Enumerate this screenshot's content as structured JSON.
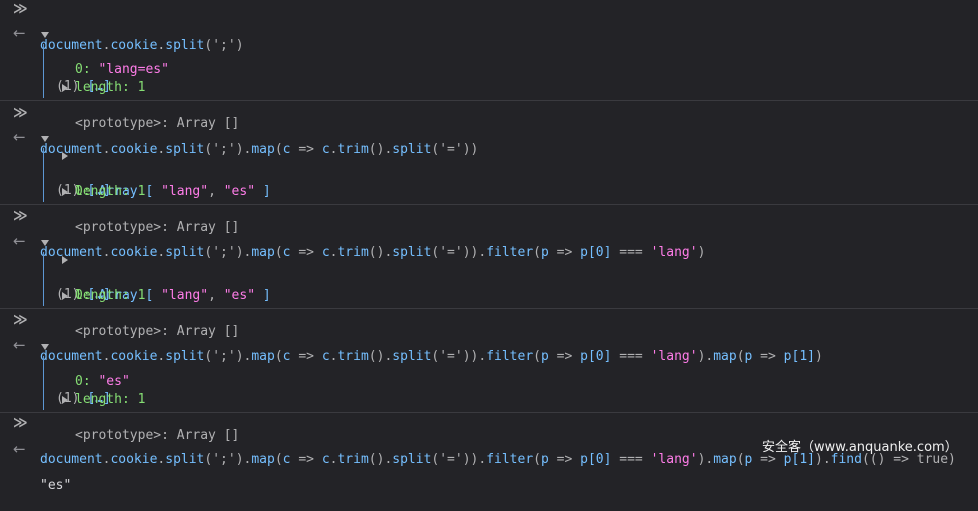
{
  "prompt_icon": "chevron-double-right-icon",
  "result_icon": "arrow-left-icon",
  "code_tokens": {
    "document": "document",
    "dot": ".",
    "cookie": "cookie",
    "split": "split",
    "open_semicolon": "(';')",
    "map": "map",
    "paren_open": "(",
    "c": "c",
    "arrow": " => ",
    "trim": "trim",
    "empty_call": "()",
    "eq_arg": "('=')",
    "close": ")",
    "filter": "filter",
    "p": "p",
    "p0": "p[0]",
    "strict_eq": " === ",
    "lang_str": "'lang'",
    "p1": "p[1]",
    "find": "find",
    "lambda_empty": "(() => true)"
  },
  "commands": [
    "document.cookie.split(';')",
    "document.cookie.split(';').map(c => c.trim().split('='))",
    "document.cookie.split(';').map(c => c.trim().split('=')).filter(p => p[0] === 'lang')",
    "document.cookie.split(';').map(c => c.trim().split('=')).filter(p => p[0] === 'lang').map(p => p[1])",
    "document.cookie.split(';').map(c => c.trim().split('=')).filter(p => p[0] === 'lang').map(p => p[1]).find(() => true)"
  ],
  "results": {
    "array_header_count": "(1) ",
    "array_header_ellipsis": "[…]",
    "r1_index": "0: ",
    "r1_value": "\"lang=es\"",
    "length_key": "length: ",
    "length_value": "1",
    "prototype_label": "<prototype>: Array []",
    "nested_index": "0: ",
    "nested_array_open": "Array [ ",
    "nested_lang": "\"lang\"",
    "nested_comma": ", ",
    "nested_es": "\"es\"",
    "nested_close": " ]",
    "r4_value": "\"es\"",
    "final_value": "\"es\""
  },
  "watermark": "安全客（www.anquanke.com）"
}
